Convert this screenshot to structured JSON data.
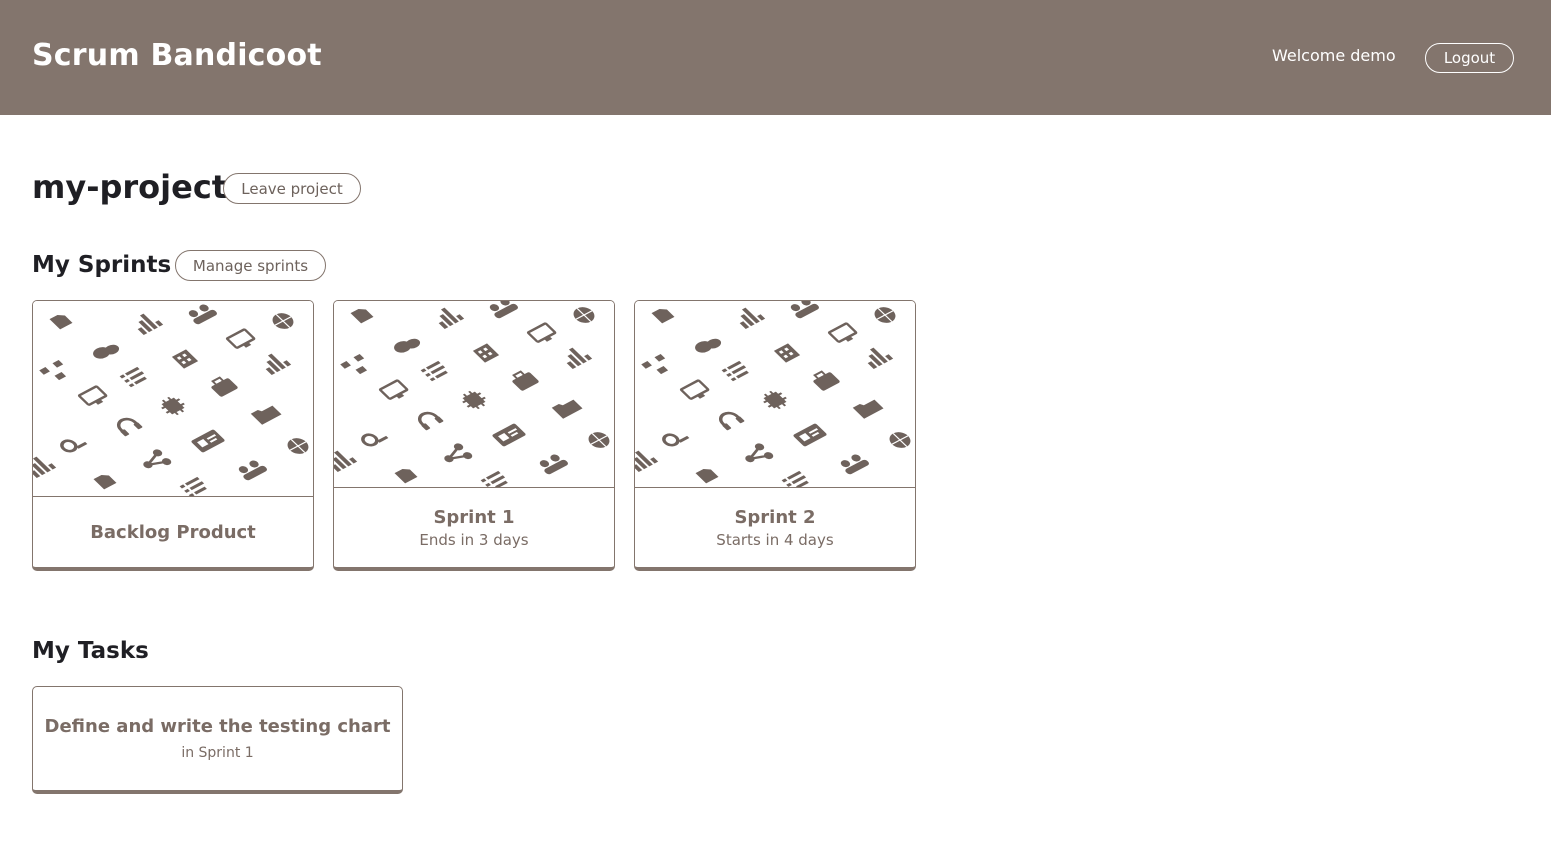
{
  "header": {
    "brand": "Scrum Bandicoot",
    "welcome": "Welcome demo",
    "logout_label": "Logout",
    "bg_color": "#83756d"
  },
  "project": {
    "title": "my-project",
    "leave_label": "Leave project"
  },
  "sprints": {
    "heading": "My Sprints",
    "manage_label": "Manage sprints",
    "cards": [
      {
        "title": "Backlog Product",
        "subtitle": ""
      },
      {
        "title": "Sprint 1",
        "subtitle": "Ends in 3 days"
      },
      {
        "title": "Sprint 2",
        "subtitle": "Starts in 4 days"
      }
    ]
  },
  "tasks": {
    "heading": "My Tasks",
    "items": [
      {
        "title": "Define and write the testing chart",
        "subtitle": "in Sprint 1"
      }
    ]
  },
  "colors": {
    "accent": "#83756d",
    "icon": "#6e625c"
  }
}
